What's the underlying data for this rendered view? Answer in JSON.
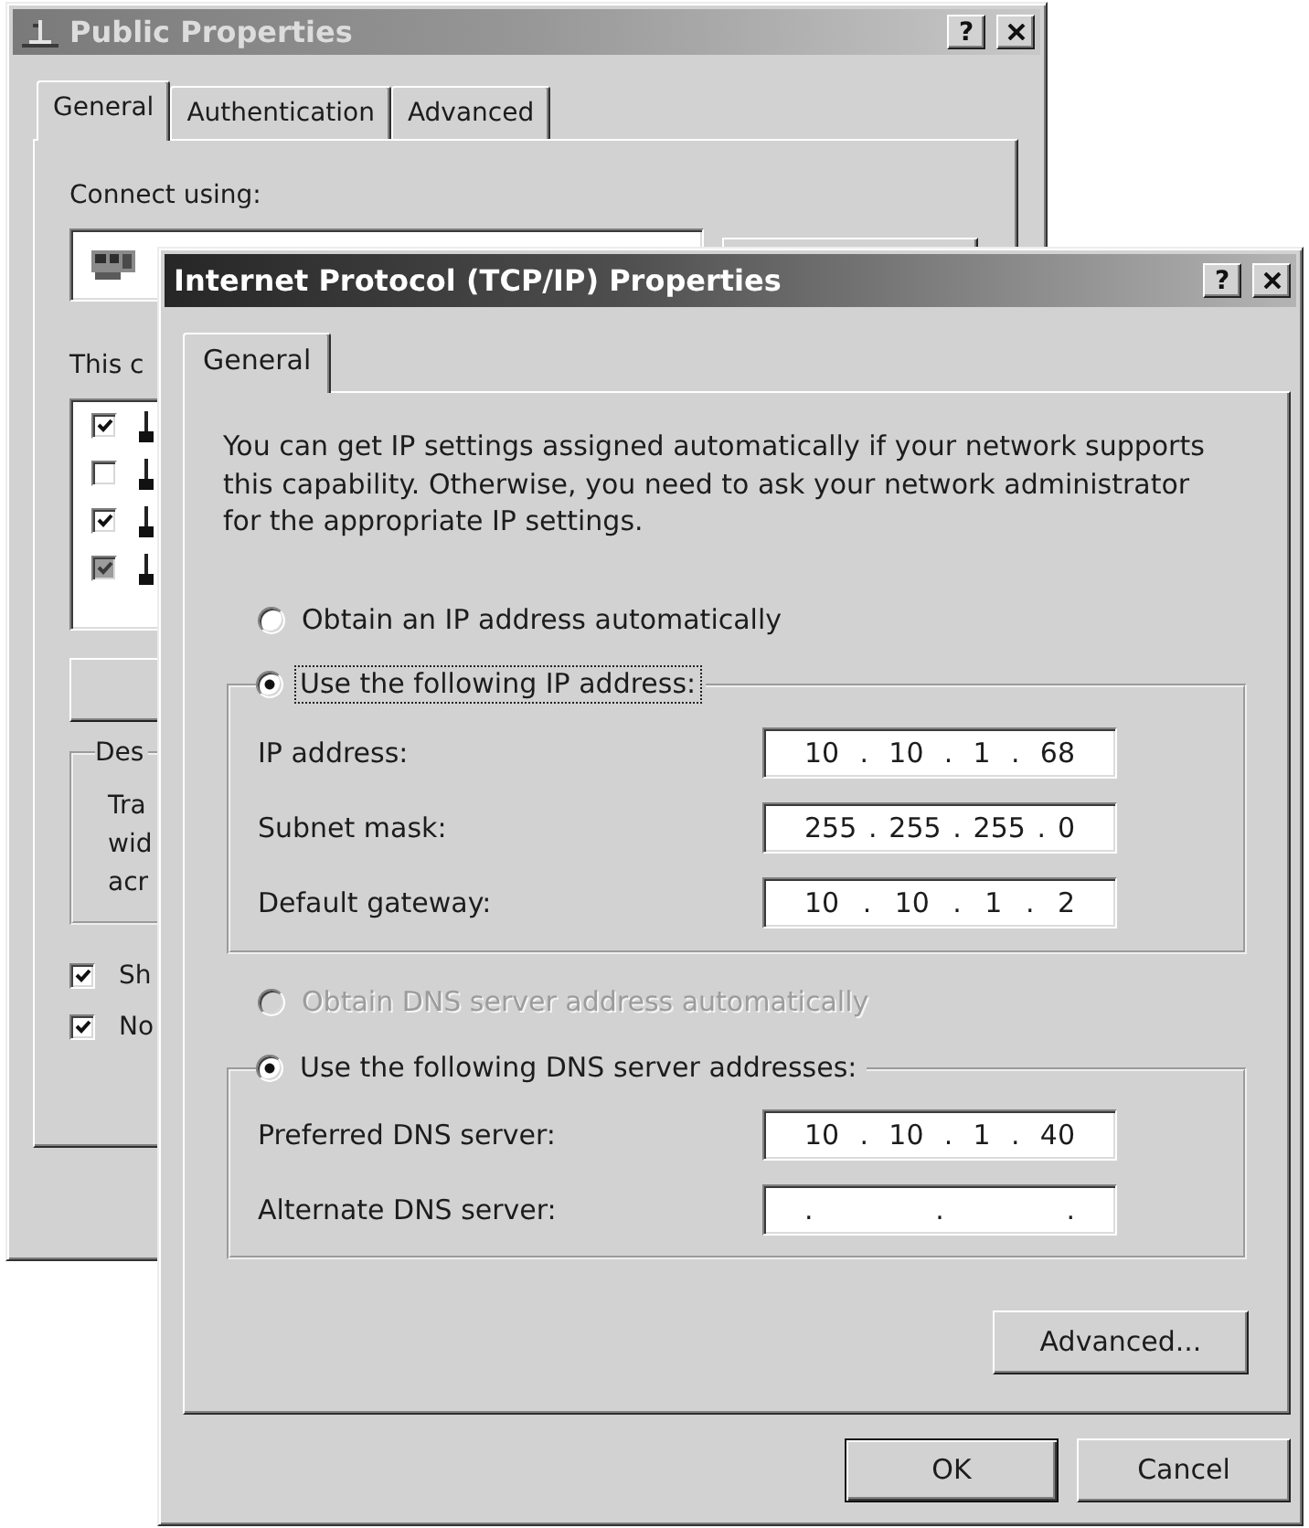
{
  "back_window": {
    "title": "Public Properties",
    "active": false,
    "help_button": "?",
    "tabs": [
      {
        "label": "General",
        "selected": true
      },
      {
        "label": "Authentication",
        "selected": false
      },
      {
        "label": "Advanced",
        "selected": false
      }
    ],
    "connect_using_label": "Connect using:",
    "components_label": "This c",
    "components": [
      {
        "checked": true,
        "disabled": false
      },
      {
        "checked": false,
        "disabled": false
      },
      {
        "checked": true,
        "disabled": false
      },
      {
        "checked": true,
        "disabled": true
      }
    ],
    "description_legend": "Des",
    "description_lines": [
      "Tra",
      "wid",
      "acr"
    ],
    "options": [
      {
        "label": "Sh",
        "checked": true
      },
      {
        "label": "No",
        "checked": true
      }
    ]
  },
  "front_window": {
    "title": "Internet Protocol (TCP/IP) Properties",
    "active": true,
    "help_button": "?",
    "tabs": [
      {
        "label": "General",
        "selected": true
      }
    ],
    "intro": "You can get IP settings assigned automatically if your network supports this capability. Otherwise, you need to ask your network administrator for the appropriate IP settings.",
    "ip_auto_option": {
      "label": "Obtain an IP address automatically",
      "selected": false,
      "disabled": false,
      "focused": false
    },
    "ip_manual_group": {
      "option": {
        "label": "Use the following IP address:",
        "selected": true,
        "disabled": false,
        "focused": true
      },
      "fields": [
        {
          "label": "IP address:",
          "value": "10 . 10 . 1 . 68"
        },
        {
          "label": "Subnet mask:",
          "value": "255 . 255 . 255 . 0"
        },
        {
          "label": "Default gateway:",
          "value": "10 . 10 . 1 . 2"
        }
      ]
    },
    "dns_auto_option": {
      "label": "Obtain DNS server address automatically",
      "selected": false,
      "disabled": true,
      "focused": false
    },
    "dns_manual_group": {
      "option": {
        "label": "Use the following DNS server addresses:",
        "selected": true,
        "disabled": false,
        "focused": false
      },
      "fields": [
        {
          "label": "Preferred DNS server:",
          "value": "10 . 10 . 1 . 40"
        },
        {
          "label": "Alternate DNS server:",
          "value": ". . ."
        }
      ]
    },
    "advanced_button": {
      "label": "Advanced...",
      "default": false
    },
    "buttons": [
      {
        "label": "OK",
        "default": true
      },
      {
        "label": "Cancel",
        "default": false
      }
    ]
  }
}
